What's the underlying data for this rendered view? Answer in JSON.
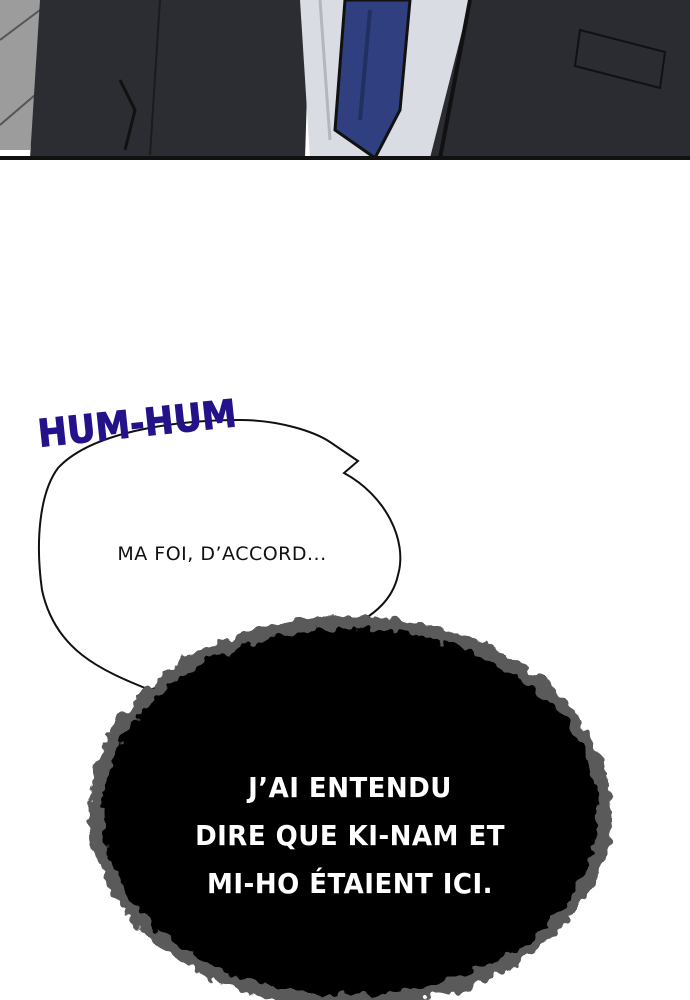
{
  "sfx": {
    "text": "HUM-HUM",
    "color": "#24128a"
  },
  "speech_bubble": {
    "text": "MA FOI, D’ACCORD..."
  },
  "dark_bubble": {
    "lines": [
      "J’AI ENTENDU",
      "DIRE QUE KI-NAM ET",
      "MI-HO ÉTAIENT ICI."
    ]
  },
  "colors": {
    "suit": "#2a2a31",
    "tie": "#2e3f7e",
    "shirt": "#d9dbe2",
    "background_gray": "#9a9a9a",
    "dark_bubble": "#000000"
  }
}
